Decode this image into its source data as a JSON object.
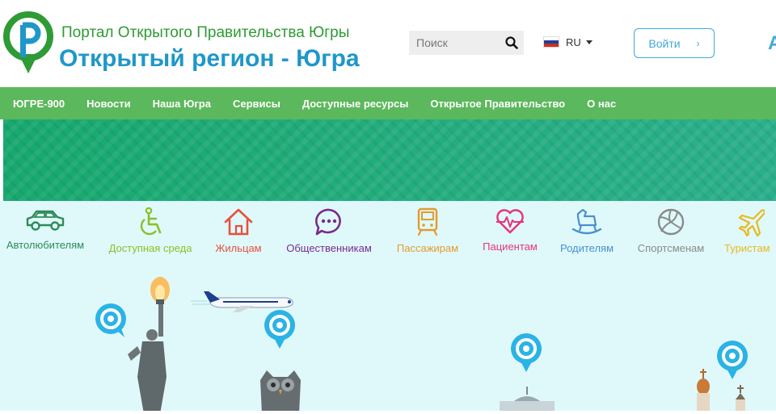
{
  "header": {
    "subtitle": "Портал Открытого Правительства Югры",
    "title": "Открытый регион - Югра",
    "search_placeholder": "Поиск",
    "language": "RU",
    "login_label": "Войти",
    "login_chevron": "›",
    "edge_letter": "А"
  },
  "nav": {
    "items": [
      {
        "label": "ЮГРЕ-900"
      },
      {
        "label": "Новости"
      },
      {
        "label": "Наша Югра"
      },
      {
        "label": "Сервисы"
      },
      {
        "label": "Доступные ресурсы"
      },
      {
        "label": "Открытое Правительство"
      },
      {
        "label": "О нас"
      }
    ]
  },
  "categories": [
    {
      "label": "Автолюбителям",
      "icon": "car-icon",
      "color": "#2e8b57"
    },
    {
      "label": "Доступная среда",
      "icon": "wheelchair-icon",
      "color": "#8cbf26"
    },
    {
      "label": "Жильцам",
      "icon": "house-icon",
      "color": "#e94f3d"
    },
    {
      "label": "Общественникам",
      "icon": "chat-bubble-icon",
      "color": "#7a2a8c"
    },
    {
      "label": "Пассажирам",
      "icon": "train-icon",
      "color": "#e39b2d"
    },
    {
      "label": "Пациентам",
      "icon": "heart-pulse-icon",
      "color": "#e8337a"
    },
    {
      "label": "Родителям",
      "icon": "rocking-horse-icon",
      "color": "#4a8fd0"
    },
    {
      "label": "Спортсменам",
      "icon": "volleyball-icon",
      "color": "#8a8a8a"
    },
    {
      "label": "Туристам",
      "icon": "airplane-icon",
      "color": "#e8b81f"
    }
  ],
  "colors": {
    "nav_green": "#5cb85c",
    "title_blue": "#1f97c9",
    "subtitle_green": "#2e9b35",
    "banner_green": "#1eaa80",
    "scene_bg": "#dff9fb",
    "pin_blue": "#2bb3e6"
  }
}
